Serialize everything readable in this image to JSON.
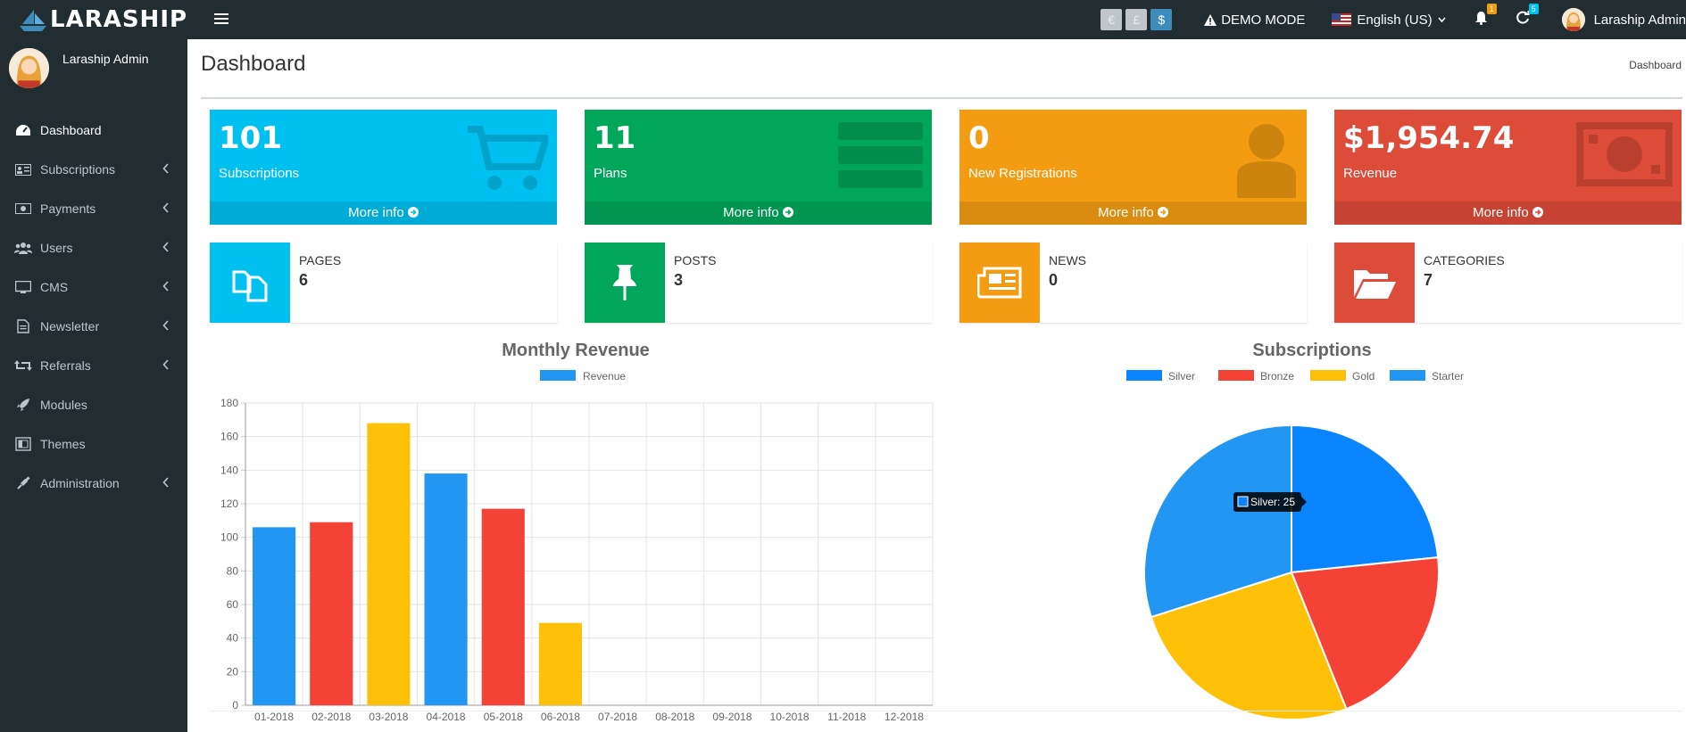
{
  "brand": {
    "name": "LARASHIP"
  },
  "topbar": {
    "currencies": [
      {
        "symbol": "€",
        "active": false
      },
      {
        "symbol": "£",
        "active": false
      },
      {
        "symbol": "$",
        "active": true
      }
    ],
    "demo_mode": "DEMO MODE",
    "language": "English (US)",
    "notifications_badge": "1",
    "updates_badge": "5",
    "user_name": "Laraship Admin"
  },
  "sidebar": {
    "user_name": "Laraship Admin",
    "items": [
      {
        "label": "Dashboard",
        "icon": "dashboard-icon",
        "active": true,
        "has_children": false
      },
      {
        "label": "Subscriptions",
        "icon": "id-card-icon",
        "active": false,
        "has_children": true
      },
      {
        "label": "Payments",
        "icon": "money-icon",
        "active": false,
        "has_children": true
      },
      {
        "label": "Users",
        "icon": "users-icon",
        "active": false,
        "has_children": true
      },
      {
        "label": "CMS",
        "icon": "desktop-icon",
        "active": false,
        "has_children": true
      },
      {
        "label": "Newsletter",
        "icon": "document-icon",
        "active": false,
        "has_children": true
      },
      {
        "label": "Referrals",
        "icon": "retweet-icon",
        "active": false,
        "has_children": true
      },
      {
        "label": "Modules",
        "icon": "rocket-icon",
        "active": false,
        "has_children": false
      },
      {
        "label": "Themes",
        "icon": "themes-icon",
        "active": false,
        "has_children": false
      },
      {
        "label": "Administration",
        "icon": "plug-icon",
        "active": false,
        "has_children": true
      }
    ]
  },
  "header": {
    "title": "Dashboard",
    "breadcrumb": "Dashboard"
  },
  "stat_boxes": [
    {
      "value": "101",
      "label": "Subscriptions",
      "more": "More info",
      "color": "#00c0ef",
      "icon": "cart-icon"
    },
    {
      "value": "11",
      "label": "Plans",
      "more": "More info",
      "color": "#00a65a",
      "icon": "list-icon"
    },
    {
      "value": "0",
      "label": "New Registrations",
      "more": "More info",
      "color": "#f39c12",
      "icon": "user-icon"
    },
    {
      "value": "$1,954.74",
      "label": "Revenue",
      "more": "More info",
      "color": "#dd4b39",
      "icon": "money-bill-icon"
    }
  ],
  "info_boxes": [
    {
      "label": "PAGES",
      "value": "6",
      "color": "#00c0ef",
      "icon": "copy-icon"
    },
    {
      "label": "POSTS",
      "value": "3",
      "color": "#00a65a",
      "icon": "thumbtack-icon"
    },
    {
      "label": "NEWS",
      "value": "0",
      "color": "#f39c12",
      "icon": "newspaper-icon"
    },
    {
      "label": "CATEGORIES",
      "value": "7",
      "color": "#dd4b39",
      "icon": "folder-open-icon"
    }
  ],
  "chart_data": [
    {
      "type": "bar",
      "title": "Monthly Revenue",
      "categories": [
        "01-2018",
        "02-2018",
        "03-2018",
        "04-2018",
        "05-2018",
        "06-2018",
        "07-2018",
        "08-2018",
        "09-2018",
        "10-2018",
        "11-2018",
        "12-2018"
      ],
      "series": [
        {
          "name": "Revenue",
          "values": [
            106,
            109,
            168,
            138,
            117,
            49,
            0,
            0,
            0,
            0,
            0,
            0
          ]
        }
      ],
      "bar_colors": [
        "#2196f3",
        "#f44336",
        "#ffc107",
        "#2196f3",
        "#f44336",
        "#ffc107",
        "#2196f3",
        "#f44336",
        "#ffc107",
        "#2196f3",
        "#f44336",
        "#ffc107"
      ],
      "legend_color": "#2196f3",
      "ylim": [
        0,
        180
      ],
      "yticks": [
        0,
        20,
        40,
        60,
        80,
        100,
        120,
        140,
        160,
        180
      ],
      "grid": true,
      "legend_position": "top"
    },
    {
      "type": "pie",
      "title": "Subscriptions",
      "labels": [
        "Silver",
        "Bronze",
        "Gold",
        "Starter"
      ],
      "values": [
        25,
        22,
        28,
        32
      ],
      "colors": [
        "#0a84ff",
        "#f44336",
        "#ffc107",
        "#2196f3"
      ],
      "tooltip": "Silver: 25",
      "legend_position": "top"
    }
  ]
}
